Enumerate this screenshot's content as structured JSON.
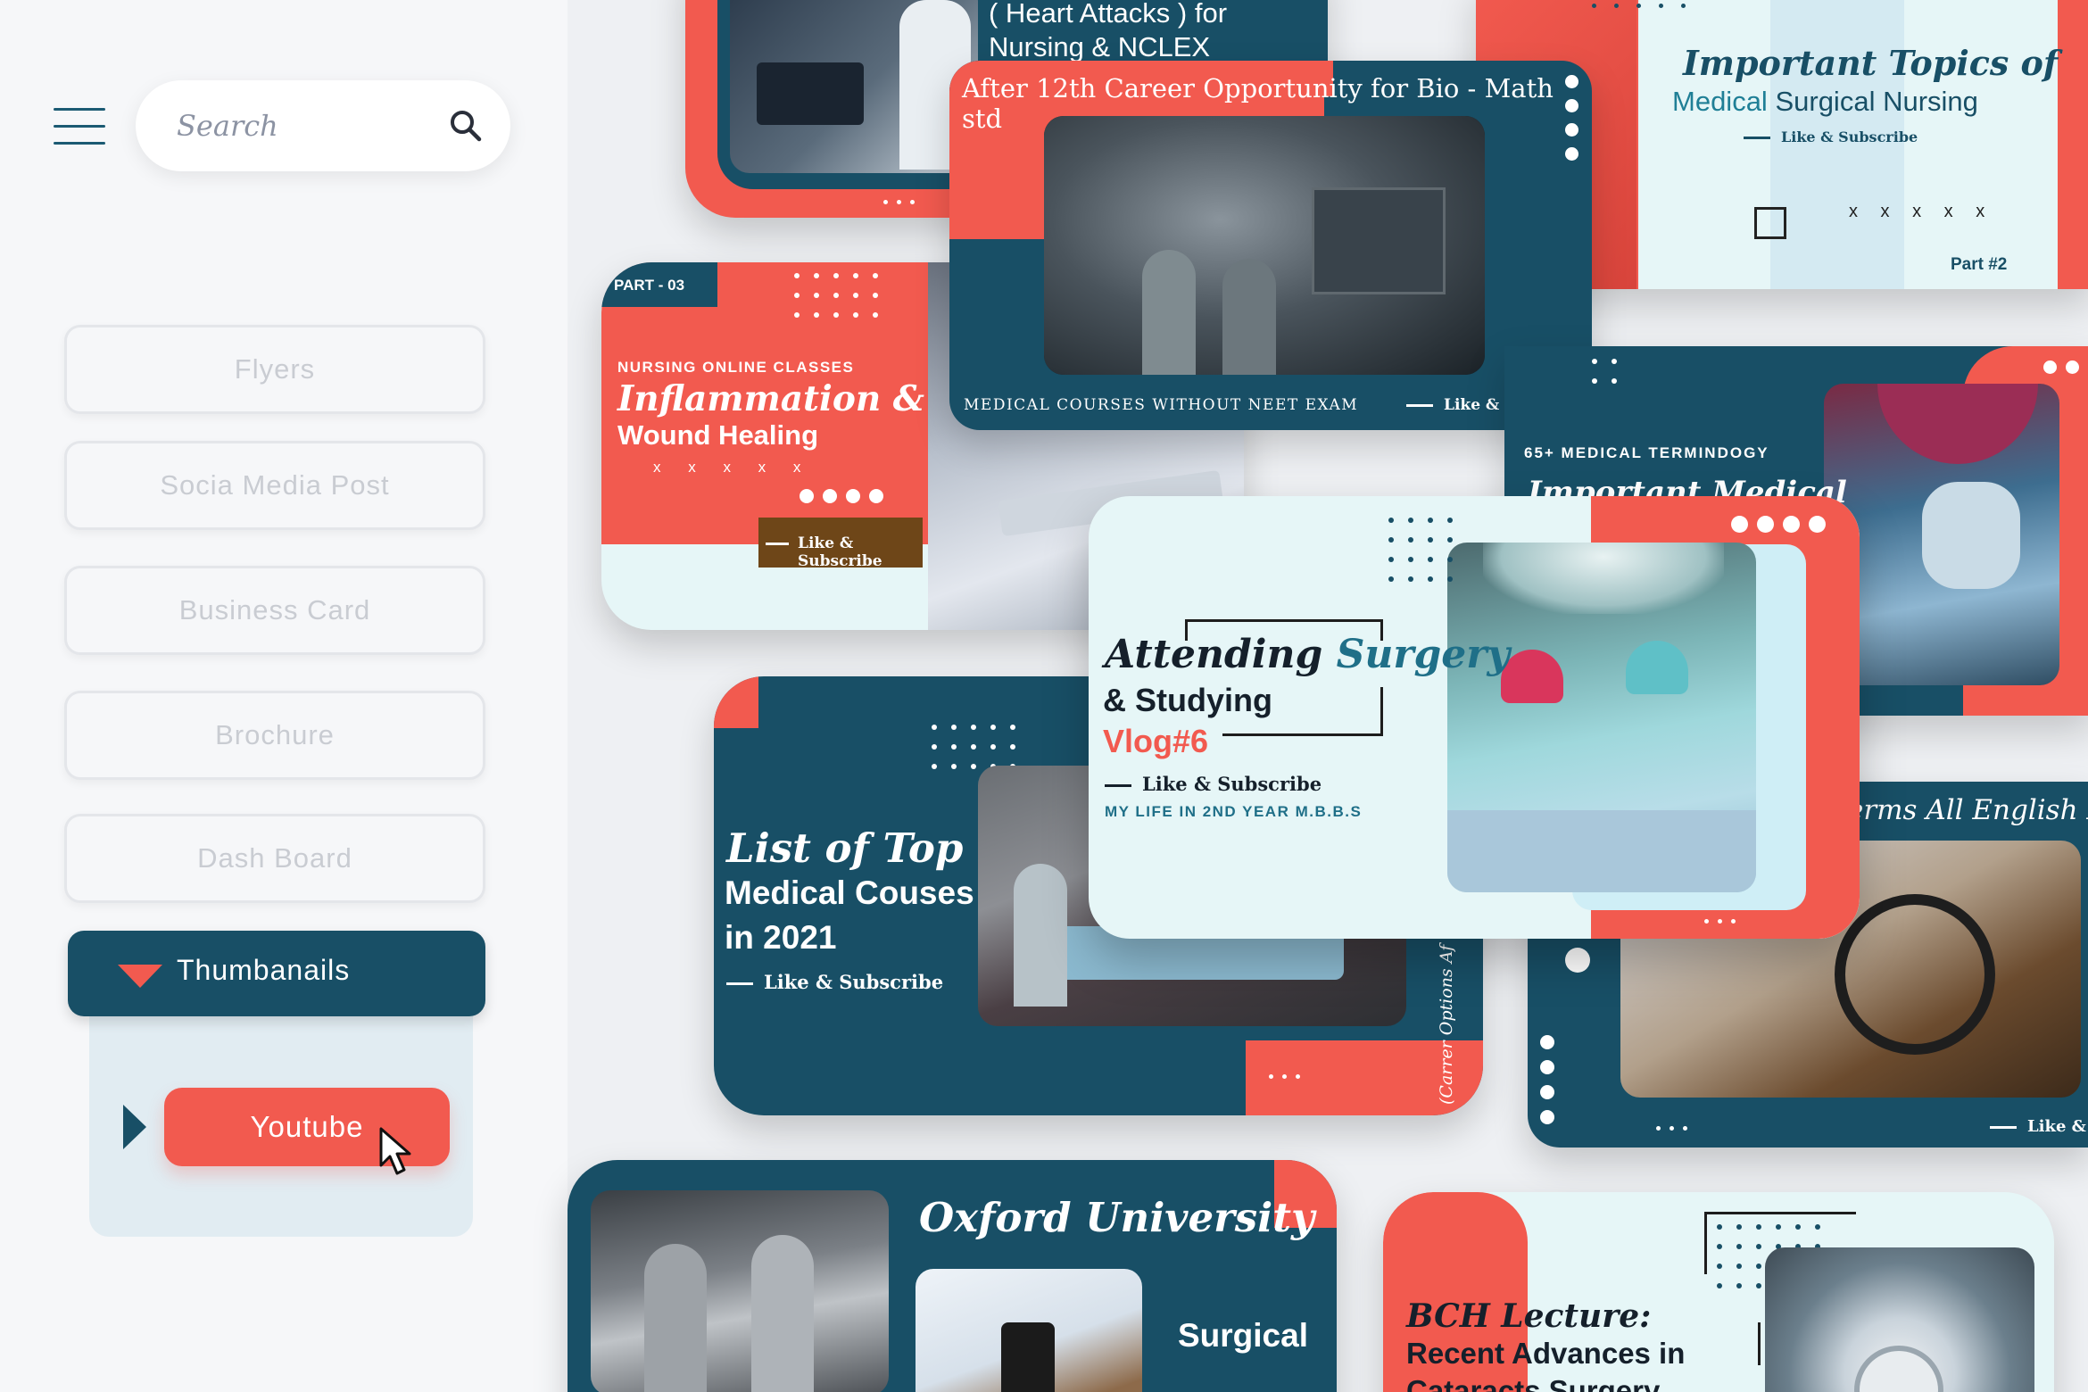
{
  "sidebar": {
    "search_placeholder": "Search",
    "nav_items": [
      {
        "label": "Flyers"
      },
      {
        "label": "Socia Media Post"
      },
      {
        "label": "Business Card"
      },
      {
        "label": "Brochure"
      },
      {
        "label": "Dash Board"
      }
    ],
    "active_category": "Thumbanails",
    "active_sub_item": "Youtube"
  },
  "colors": {
    "teal": "#184f66",
    "coral": "#f25a4f",
    "mint": "#e6f6f7",
    "brown": "#6e4618"
  },
  "thumbnails": {
    "heart": {
      "line1": "( Heart Attacks ) for",
      "line2": "Nursing & NCLEX"
    },
    "career": {
      "title": "After 12th Career Opportunity for Bio - Math std",
      "footer": "MEDICAL COURSES WITHOUT NEET EXAM",
      "like": "Like & Subscribe"
    },
    "topics": {
      "title_italic": "Important Topics of",
      "title_colored": "Medical",
      "title_rest": "Surgical Nursing",
      "like": "Like & Subscribe",
      "marks": "x x x x x",
      "part": "Part #2"
    },
    "inflammation": {
      "part": "PART - 03",
      "kicker": "NURSING ONLINE CLASSES",
      "title1": "Inflammation &",
      "title2": "Wound Healing",
      "marks": "x x x x x",
      "like": "Like & Subscribe"
    },
    "terminology": {
      "kicker": "65+ MEDICAL TERMINDOGY",
      "title": "Important Medical"
    },
    "vlog": {
      "title_italic": "Attending",
      "title_colored": "Surgery",
      "line2": "& Studying",
      "line3": "Vlog#6",
      "like": "Like & Subscribe",
      "sub": "MY LIFE IN 2ND YEAR M.B.B.S"
    },
    "list": {
      "title_italic": "List of Top",
      "line2": "Medical Couses",
      "line3": "in 2021",
      "like": "Like & Subscribe",
      "side": "(Carrer Options Af"
    },
    "english": {
      "title": "erms All English Lea",
      "like": "Like & S"
    },
    "oxford": {
      "title": "Oxford University",
      "sub": "Surgical"
    },
    "bch": {
      "title_italic": "BCH Lecture:",
      "line2": "Recent Advances in",
      "line3": "Cataracts Surgery"
    }
  }
}
